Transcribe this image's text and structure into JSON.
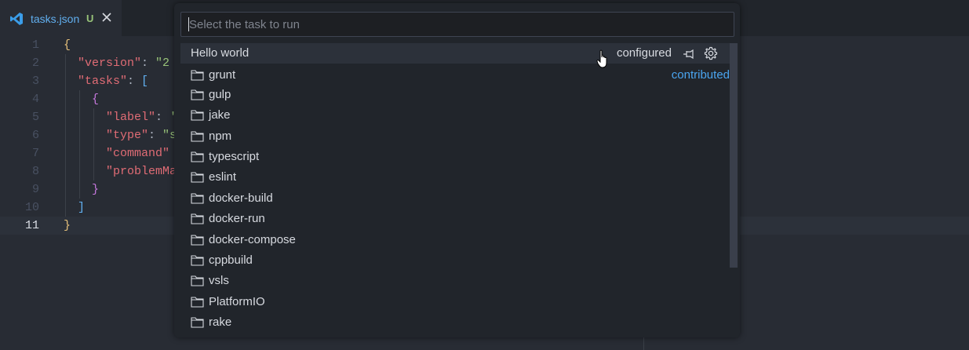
{
  "tab": {
    "filename": "tasks.json",
    "status": "U",
    "file_icon": "vscode-icon",
    "close_icon": "close-icon"
  },
  "editor": {
    "lines": [
      {
        "n": "1"
      },
      {
        "n": "2"
      },
      {
        "n": "3"
      },
      {
        "n": "4"
      },
      {
        "n": "5"
      },
      {
        "n": "6"
      },
      {
        "n": "7"
      },
      {
        "n": "8"
      },
      {
        "n": "9"
      },
      {
        "n": "10"
      },
      {
        "n": "11"
      }
    ],
    "code": {
      "l1": "{",
      "l2_key": "\"version\"",
      "l2_colon": ": ",
      "l2_val": "\"2",
      "l3_key": "\"tasks\"",
      "l3_colon": ": ",
      "l3_bracket": "[",
      "l4": "{",
      "l5_key": "\"label\"",
      "l5_colon": ": ",
      "l5_val": "'",
      "l6_key": "\"type\"",
      "l6_colon": ": ",
      "l6_val": "\"s",
      "l7_key": "\"command\"",
      "l8_key": "\"problemMa",
      "l9": "}",
      "l10": "]",
      "l11": "}"
    }
  },
  "quickpick": {
    "placeholder": "Select the task to run",
    "selected": {
      "label": "Hello world",
      "description": "configured",
      "pin_icon": "pin-icon",
      "gear_icon": "gear-icon"
    },
    "contributed_label": "contributed",
    "items": [
      "grunt",
      "gulp",
      "jake",
      "npm",
      "typescript",
      "eslint",
      "docker-build",
      "docker-run",
      "docker-compose",
      "cppbuild",
      "vsls",
      "PlatformIO",
      "rake"
    ]
  },
  "colors": {
    "background": "#282c34",
    "accent": "#61afef",
    "string": "#98c379",
    "key": "#e06c75",
    "link": "#4aa5f0"
  }
}
